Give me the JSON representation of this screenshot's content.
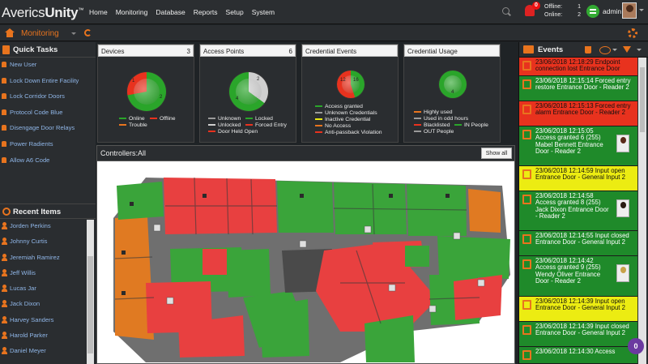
{
  "brand": {
    "name_light": "Averics",
    "name_bold": "Unity",
    "tm": "™"
  },
  "nav": [
    "Home",
    "Monitoring",
    "Database",
    "Reports",
    "Setup",
    "System"
  ],
  "notifications": {
    "count": "0"
  },
  "status": {
    "offline_label": "Offline:",
    "offline_value": "1",
    "online_label": "Online:",
    "online_value": "2"
  },
  "user": {
    "name": "admin"
  },
  "section": {
    "title": "Monitoring"
  },
  "quick_tasks": {
    "title": "Quick Tasks",
    "items": [
      "New User",
      "Lock Down Entire Facility",
      "Lock Corridor Doors",
      "Protocol Code Blue",
      "Disengage Door Relays",
      "Power Radients",
      "Allow A6 Code"
    ]
  },
  "recent_items": {
    "title": "Recent Items",
    "items": [
      "Jorden Perkins",
      "Johnny Curtis",
      "Jeremiah Ramirez",
      "Jeff Willis",
      "Lucas Jar",
      "Jack Dixon",
      "Harvey Sanders",
      "Harold Parker",
      "Daniel Meyer"
    ]
  },
  "widgets": {
    "devices": {
      "title": "Devices",
      "count": "3",
      "legend": [
        "Online",
        "Offline",
        "Trouble"
      ],
      "pie_labels": [
        "1",
        "2"
      ]
    },
    "access_points": {
      "title": "Access Points",
      "count": "6",
      "legend": [
        "Unknown",
        "Locked",
        "Unlocked",
        "Forced Entry",
        "Door Held Open"
      ],
      "pie_labels": [
        "2",
        "4"
      ]
    },
    "credential_events": {
      "title": "Credential Events",
      "legend": [
        "Access granted",
        "Unknown Credentials",
        "Inactive Credential",
        "No Access",
        "Anti-passback Violation"
      ],
      "pie_labels": [
        "12",
        "16"
      ]
    },
    "credential_usage": {
      "title": "Credential Usage",
      "legend": [
        "Highly used",
        "Used in odd hours",
        "Blacklisted",
        "IN People",
        "OUT People"
      ],
      "pie_labels": [
        "4"
      ]
    }
  },
  "colors": {
    "online": "#2aa52a",
    "offline": "#e8321e",
    "trouble": "#e8741e",
    "unknown": "#9a9a9a",
    "locked": "#2aa52a",
    "unlocked": "#cfcfcf",
    "forced": "#e8321e",
    "held": "#e8321e",
    "accent": "#e8741e"
  },
  "controllers": {
    "title": "Controllers:All",
    "show_all": "Show all"
  },
  "events": {
    "title": "Events",
    "items": [
      {
        "type": "red",
        "text": "23/06/2018 12:18:29 Endpoint connection lost  Entrance Door"
      },
      {
        "type": "green",
        "text": "23/06/2018 12:15:14 Forced entry restore  Entrance Door - Reader 2"
      },
      {
        "type": "red",
        "text": "23/06/2018 12:15:13 Forced entry alarm  Entrance Door - Reader 2"
      },
      {
        "type": "green",
        "text": "23/06/2018 12:15:05 Access granted  6 (255)  Mabel Bennett  Entrance Door - Reader 2",
        "photo": true,
        "face": "#5a2a1a"
      },
      {
        "type": "yellow",
        "text": "23/06/2018 12:14:59  Input open  Entrance Door - General Input 2"
      },
      {
        "type": "green",
        "text": "23/06/2018 12:14:58 Access granted  8 (255)  Jack Dixon  Entrance Door - Reader 2",
        "photo": true,
        "face": "#2a1a12"
      },
      {
        "type": "green",
        "text": "23/06/2018 12:14:55  Input closed  Entrance Door - General Input 2"
      },
      {
        "type": "green",
        "text": "23/06/2018 12:14:42 Access granted  9 (255)  Wendy Oliver  Entrance Door - Reader 2",
        "photo": true,
        "face": "#c8a24a"
      },
      {
        "type": "yellow",
        "text": "23/06/2018 12:14:39  Input open  Entrance Door - General Input 2"
      },
      {
        "type": "green",
        "text": "23/06/2018 12:14:39  Input closed  Entrance Door - General Input 2"
      },
      {
        "type": "green",
        "text": "23/06/2018 12:14:30 Access"
      }
    ]
  },
  "floating_badge": "0"
}
